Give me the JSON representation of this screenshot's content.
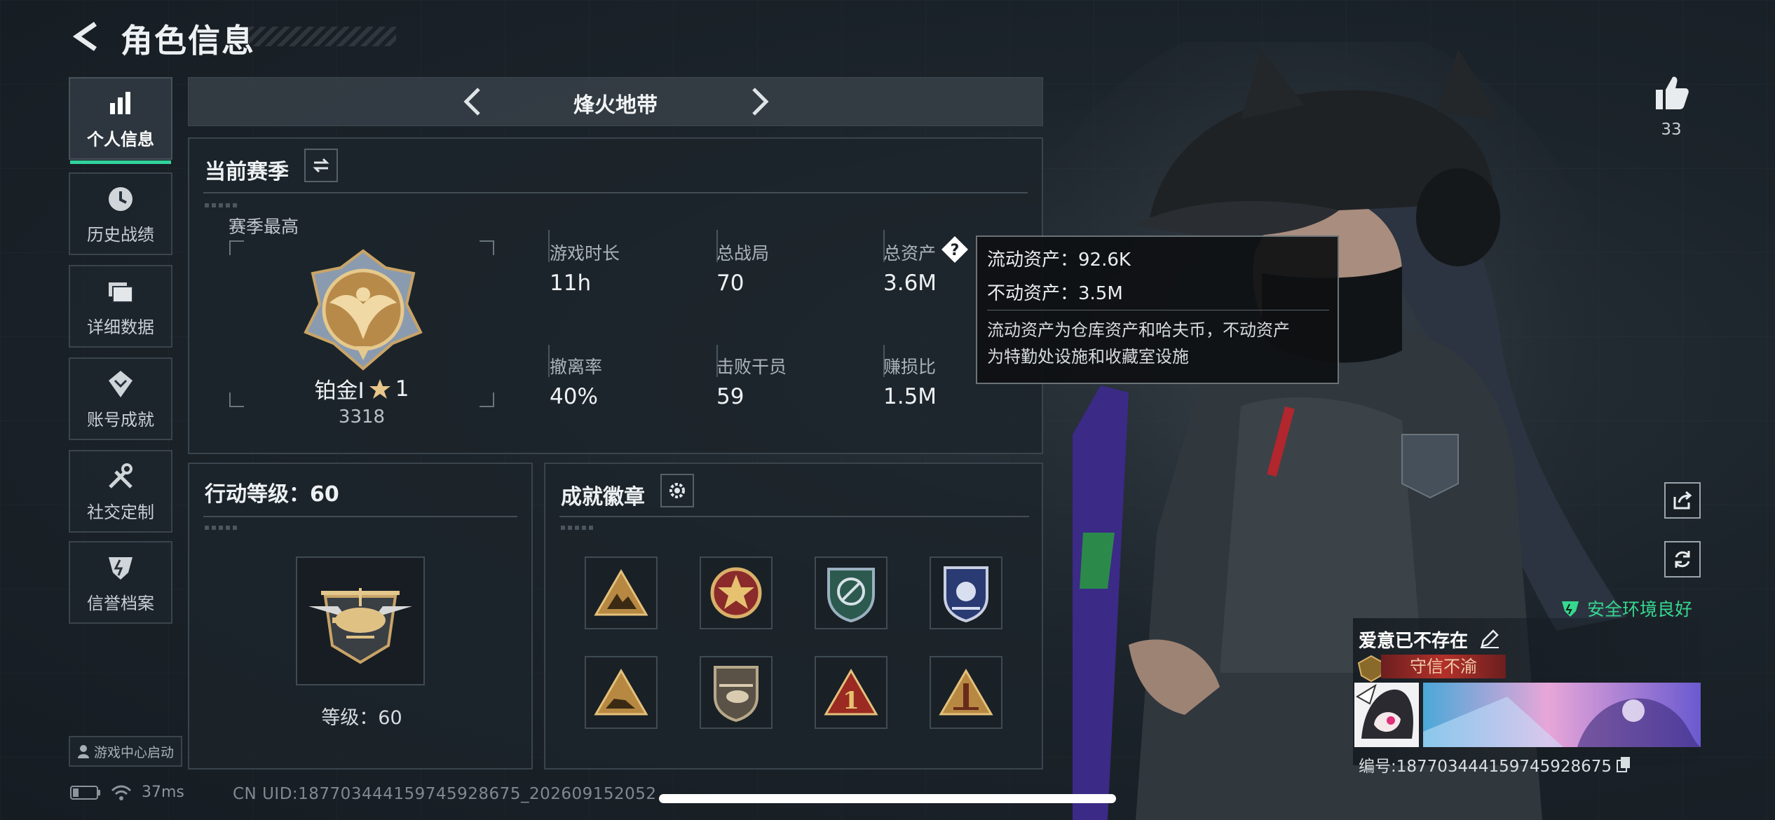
{
  "header": {
    "title": "角色信息"
  },
  "sidebar": {
    "items": [
      {
        "label": "个人信息",
        "icon": "bar-chart-icon",
        "active": true
      },
      {
        "label": "历史战绩",
        "icon": "clock-icon"
      },
      {
        "label": "详细数据",
        "icon": "folder-icon"
      },
      {
        "label": "账号成就",
        "icon": "achievement-icon"
      },
      {
        "label": "社交定制",
        "icon": "tools-icon"
      },
      {
        "label": "信誉档案",
        "icon": "shield-icon"
      }
    ],
    "game_center": "游戏中心启动"
  },
  "status": {
    "ping": "37ms",
    "uid": "CN UID:18770344415974592867​5_202609152052"
  },
  "mode": {
    "title": "烽火地带"
  },
  "season": {
    "title": "当前赛季",
    "best_label": "赛季最高",
    "rank_name": "铂金Ⅰ",
    "rank_stars": "1",
    "rank_points": "3318",
    "stats": [
      {
        "label": "游戏时长",
        "value": "11h"
      },
      {
        "label": "总战局",
        "value": "70"
      },
      {
        "label": "总资产",
        "value": "3.6M"
      },
      {
        "label": "撤离率",
        "value": "40%"
      },
      {
        "label": "击败干员",
        "value": "59"
      },
      {
        "label": "赚损比",
        "value": "1.5M"
      }
    ]
  },
  "tooltip": {
    "line1": "流动资产：92.6K",
    "line2": "不动资产：3.5M",
    "note_line1": "流动资产为仓库资产和哈夫币，不动资产",
    "note_line2": "为特勤处设施和收藏室设施"
  },
  "level": {
    "title": "行动等级：60",
    "label": "等级：60"
  },
  "achievements": {
    "title": "成就徽章",
    "badges": [
      "badge-triangle-mountain",
      "badge-red-star",
      "badge-shield-arrows",
      "badge-shield-blue",
      "badge-triangle-rock",
      "badge-helicopter",
      "badge-triangle-one",
      "badge-triangle-tower"
    ]
  },
  "right": {
    "likes": "33",
    "safe_text": "安全环境良好",
    "player_name": "爱意已不存在",
    "player_tag": "守信不渝",
    "player_id": "编号:187703444159745928675"
  },
  "colors": {
    "accent": "#32d29c",
    "safe": "#36d78f",
    "panel_bg": "#1c242b"
  }
}
